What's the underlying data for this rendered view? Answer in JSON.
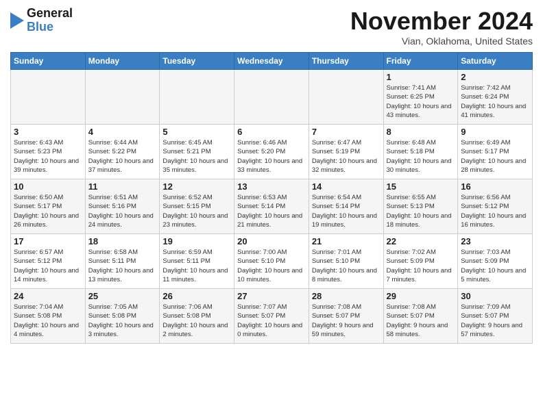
{
  "logo": {
    "line1": "General",
    "line2": "Blue"
  },
  "title": "November 2024",
  "subtitle": "Vian, Oklahoma, United States",
  "headers": [
    "Sunday",
    "Monday",
    "Tuesday",
    "Wednesday",
    "Thursday",
    "Friday",
    "Saturday"
  ],
  "weeks": [
    [
      {
        "day": "",
        "info": ""
      },
      {
        "day": "",
        "info": ""
      },
      {
        "day": "",
        "info": ""
      },
      {
        "day": "",
        "info": ""
      },
      {
        "day": "",
        "info": ""
      },
      {
        "day": "1",
        "info": "Sunrise: 7:41 AM\nSunset: 6:25 PM\nDaylight: 10 hours and 43 minutes."
      },
      {
        "day": "2",
        "info": "Sunrise: 7:42 AM\nSunset: 6:24 PM\nDaylight: 10 hours and 41 minutes."
      }
    ],
    [
      {
        "day": "3",
        "info": "Sunrise: 6:43 AM\nSunset: 5:23 PM\nDaylight: 10 hours and 39 minutes."
      },
      {
        "day": "4",
        "info": "Sunrise: 6:44 AM\nSunset: 5:22 PM\nDaylight: 10 hours and 37 minutes."
      },
      {
        "day": "5",
        "info": "Sunrise: 6:45 AM\nSunset: 5:21 PM\nDaylight: 10 hours and 35 minutes."
      },
      {
        "day": "6",
        "info": "Sunrise: 6:46 AM\nSunset: 5:20 PM\nDaylight: 10 hours and 33 minutes."
      },
      {
        "day": "7",
        "info": "Sunrise: 6:47 AM\nSunset: 5:19 PM\nDaylight: 10 hours and 32 minutes."
      },
      {
        "day": "8",
        "info": "Sunrise: 6:48 AM\nSunset: 5:18 PM\nDaylight: 10 hours and 30 minutes."
      },
      {
        "day": "9",
        "info": "Sunrise: 6:49 AM\nSunset: 5:17 PM\nDaylight: 10 hours and 28 minutes."
      }
    ],
    [
      {
        "day": "10",
        "info": "Sunrise: 6:50 AM\nSunset: 5:17 PM\nDaylight: 10 hours and 26 minutes."
      },
      {
        "day": "11",
        "info": "Sunrise: 6:51 AM\nSunset: 5:16 PM\nDaylight: 10 hours and 24 minutes."
      },
      {
        "day": "12",
        "info": "Sunrise: 6:52 AM\nSunset: 5:15 PM\nDaylight: 10 hours and 23 minutes."
      },
      {
        "day": "13",
        "info": "Sunrise: 6:53 AM\nSunset: 5:14 PM\nDaylight: 10 hours and 21 minutes."
      },
      {
        "day": "14",
        "info": "Sunrise: 6:54 AM\nSunset: 5:14 PM\nDaylight: 10 hours and 19 minutes."
      },
      {
        "day": "15",
        "info": "Sunrise: 6:55 AM\nSunset: 5:13 PM\nDaylight: 10 hours and 18 minutes."
      },
      {
        "day": "16",
        "info": "Sunrise: 6:56 AM\nSunset: 5:12 PM\nDaylight: 10 hours and 16 minutes."
      }
    ],
    [
      {
        "day": "17",
        "info": "Sunrise: 6:57 AM\nSunset: 5:12 PM\nDaylight: 10 hours and 14 minutes."
      },
      {
        "day": "18",
        "info": "Sunrise: 6:58 AM\nSunset: 5:11 PM\nDaylight: 10 hours and 13 minutes."
      },
      {
        "day": "19",
        "info": "Sunrise: 6:59 AM\nSunset: 5:11 PM\nDaylight: 10 hours and 11 minutes."
      },
      {
        "day": "20",
        "info": "Sunrise: 7:00 AM\nSunset: 5:10 PM\nDaylight: 10 hours and 10 minutes."
      },
      {
        "day": "21",
        "info": "Sunrise: 7:01 AM\nSunset: 5:10 PM\nDaylight: 10 hours and 8 minutes."
      },
      {
        "day": "22",
        "info": "Sunrise: 7:02 AM\nSunset: 5:09 PM\nDaylight: 10 hours and 7 minutes."
      },
      {
        "day": "23",
        "info": "Sunrise: 7:03 AM\nSunset: 5:09 PM\nDaylight: 10 hours and 5 minutes."
      }
    ],
    [
      {
        "day": "24",
        "info": "Sunrise: 7:04 AM\nSunset: 5:08 PM\nDaylight: 10 hours and 4 minutes."
      },
      {
        "day": "25",
        "info": "Sunrise: 7:05 AM\nSunset: 5:08 PM\nDaylight: 10 hours and 3 minutes."
      },
      {
        "day": "26",
        "info": "Sunrise: 7:06 AM\nSunset: 5:08 PM\nDaylight: 10 hours and 2 minutes."
      },
      {
        "day": "27",
        "info": "Sunrise: 7:07 AM\nSunset: 5:07 PM\nDaylight: 10 hours and 0 minutes."
      },
      {
        "day": "28",
        "info": "Sunrise: 7:08 AM\nSunset: 5:07 PM\nDaylight: 9 hours and 59 minutes."
      },
      {
        "day": "29",
        "info": "Sunrise: 7:08 AM\nSunset: 5:07 PM\nDaylight: 9 hours and 58 minutes."
      },
      {
        "day": "30",
        "info": "Sunrise: 7:09 AM\nSunset: 5:07 PM\nDaylight: 9 hours and 57 minutes."
      }
    ]
  ]
}
